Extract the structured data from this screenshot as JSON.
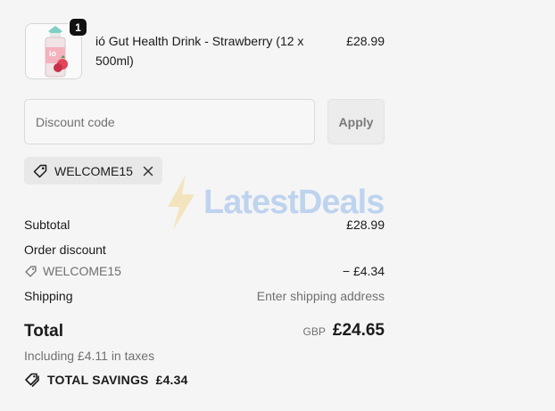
{
  "product": {
    "name": "ió Gut Health Drink - Strawberry (12 x 500ml)",
    "price": "£28.99",
    "quantity": "1",
    "image_label": "io"
  },
  "discount": {
    "placeholder": "Discount code",
    "apply_label": "Apply",
    "applied_code": "WELCOME15"
  },
  "watermark": {
    "text": "LatestDeals"
  },
  "summary": {
    "subtotal_label": "Subtotal",
    "subtotal_value": "£28.99",
    "order_discount_label": "Order discount",
    "discount_code": "WELCOME15",
    "discount_value": "− £4.34",
    "shipping_label": "Shipping",
    "shipping_value": "Enter shipping address",
    "total_label": "Total",
    "currency": "GBP",
    "total_value": "£24.65",
    "tax_note": "Including £4.11 in taxes",
    "savings_label": "TOTAL SAVINGS",
    "savings_value": "£4.34"
  },
  "colors": {
    "background": "#f5f5f5",
    "text": "#1a1a1a",
    "muted": "#707070",
    "watermark_blue": "#4d8fe0",
    "watermark_bolt": "#f2c14e"
  },
  "icons": {
    "discount_tag": "tag-icon",
    "remove": "close-icon",
    "savings": "tags-icon"
  }
}
